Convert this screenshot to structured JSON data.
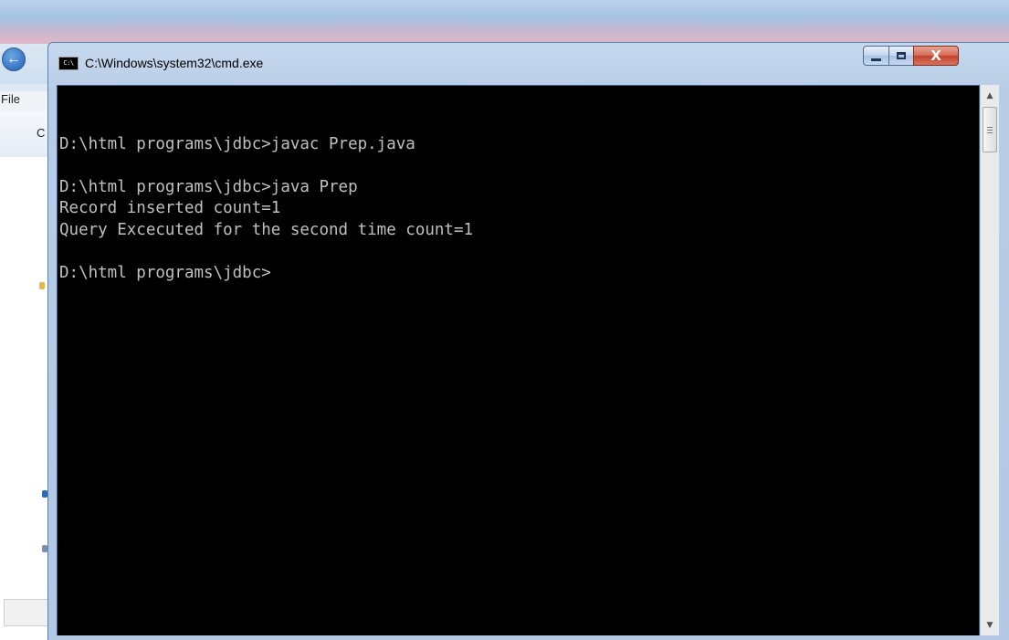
{
  "background_window": {
    "menu_file_label": "File",
    "toolbar_partial_label": "C"
  },
  "cmd_window": {
    "title": "C:\\Windows\\system32\\cmd.exe",
    "icon_text": "C:\\",
    "buttons": {
      "minimize": "minimize",
      "maximize": "maximize",
      "close": "X"
    },
    "console_lines": [
      "",
      "D:\\html programs\\jdbc>javac Prep.java",
      "",
      "D:\\html programs\\jdbc>java Prep",
      "Record inserted count=1",
      "Query Excecuted for the second time count=1",
      "",
      "D:\\html programs\\jdbc>"
    ],
    "scrollbar": {
      "up_arrow": "▲",
      "down_arrow": "▼"
    }
  },
  "colors": {
    "console_background": "#000000",
    "console_text": "#c0c0c0",
    "close_button": "#c0432d",
    "titlebar": "#b8cde6"
  }
}
